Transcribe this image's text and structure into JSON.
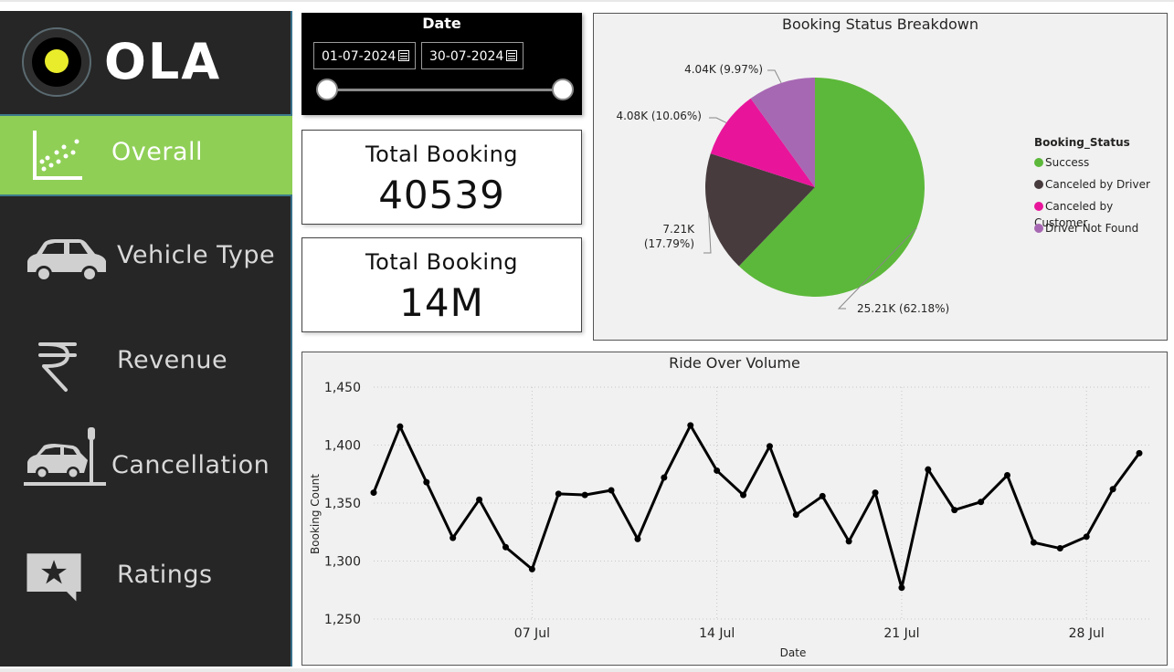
{
  "brand": {
    "name": "OLA"
  },
  "nav": {
    "items": [
      {
        "label": "Overall",
        "icon": "scatter-chart-icon",
        "active": true
      },
      {
        "label": "Vehicle Type",
        "icon": "car-icon",
        "active": false
      },
      {
        "label": "Revenue",
        "icon": "rupee-icon",
        "active": false
      },
      {
        "label": "Cancellation",
        "icon": "car-crash-icon",
        "active": false
      },
      {
        "label": "Ratings",
        "icon": "star-rating-icon",
        "active": false
      }
    ]
  },
  "date_filter": {
    "title": "Date",
    "start": "01-07-2024",
    "end": "30-07-2024",
    "range_start_fraction": 0,
    "range_end_fraction": 1
  },
  "kpis": [
    {
      "title": "Total Booking",
      "value": "40539"
    },
    {
      "title": "Total Booking",
      "value": "14M"
    }
  ],
  "colors": {
    "accent": "#8fcf56",
    "sidebar": "#262626",
    "success": "#5cb83a",
    "canceled_by_driver": "#473b3d",
    "canceled_by_customer": "#e8159b",
    "driver_not_found": "#a768b3"
  },
  "chart_data": [
    {
      "type": "pie",
      "title": "Booking Status Breakdown",
      "legend_title": "Booking_Status",
      "legend_position": "right",
      "slices": [
        {
          "name": "Success",
          "value": 25.21,
          "label": "25.21K (62.18%)",
          "color": "#5cb83a"
        },
        {
          "name": "Canceled by Driver",
          "value": 7.21,
          "label_line1": "7.21K",
          "label_line2": "(17.79%)",
          "color": "#473b3d"
        },
        {
          "name": "Canceled by Customer",
          "value": 4.08,
          "label": "4.08K (10.06%)",
          "color": "#e8159b"
        },
        {
          "name": "Driver Not Found",
          "value": 4.04,
          "label": "4.04K (9.97%)",
          "color": "#a768b3"
        }
      ]
    },
    {
      "type": "line",
      "title": "Ride Over Volume",
      "xlabel": "Date",
      "ylabel": "Booking Count",
      "ylim": [
        1250,
        1450
      ],
      "yticks": [
        "1,450",
        "1,400",
        "1,350",
        "1,300",
        "1,250"
      ],
      "xticks": [
        "07 Jul",
        "14 Jul",
        "21 Jul",
        "28 Jul"
      ],
      "x": [
        "2024-07-01",
        "2024-07-02",
        "2024-07-03",
        "2024-07-04",
        "2024-07-05",
        "2024-07-06",
        "2024-07-07",
        "2024-07-08",
        "2024-07-09",
        "2024-07-10",
        "2024-07-11",
        "2024-07-12",
        "2024-07-13",
        "2024-07-14",
        "2024-07-15",
        "2024-07-16",
        "2024-07-17",
        "2024-07-18",
        "2024-07-19",
        "2024-07-20",
        "2024-07-21",
        "2024-07-22",
        "2024-07-23",
        "2024-07-24",
        "2024-07-25",
        "2024-07-26",
        "2024-07-27",
        "2024-07-28",
        "2024-07-29",
        "2024-07-30"
      ],
      "values": [
        1359,
        1416,
        1368,
        1320,
        1353,
        1312,
        1293,
        1358,
        1357,
        1361,
        1319,
        1372,
        1417,
        1378,
        1357,
        1399,
        1340,
        1356,
        1317,
        1359,
        1277,
        1379,
        1344,
        1351,
        1374,
        1316,
        1311,
        1321,
        1362,
        1393
      ],
      "grid": true
    }
  ]
}
